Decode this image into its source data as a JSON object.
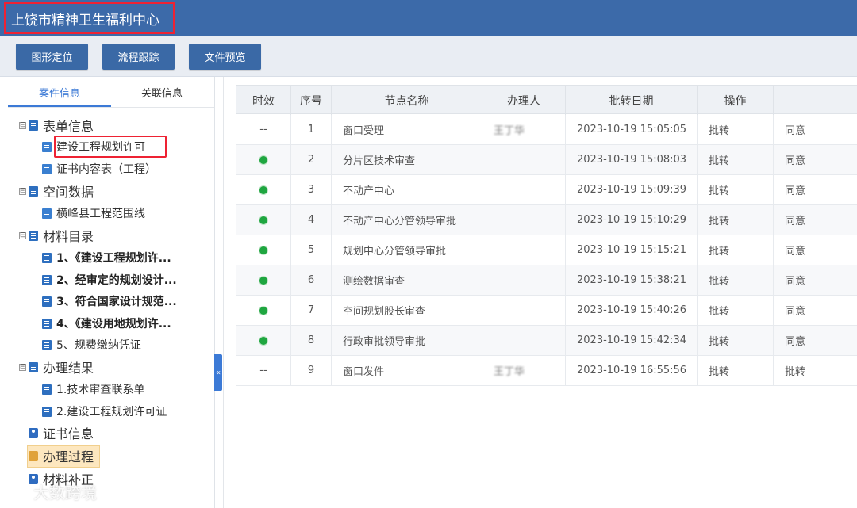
{
  "header": {
    "title": "上饶市精神卫生福利中心"
  },
  "toolbar": {
    "buttons": [
      "图形定位",
      "流程跟踪",
      "文件预览"
    ]
  },
  "sidebar": {
    "tabs": [
      "案件信息",
      "关联信息"
    ],
    "tree": [
      {
        "label": "表单信息",
        "toggle": "⊟"
      },
      {
        "label": "建设工程规划许可"
      },
      {
        "label": "证书内容表（工程）"
      },
      {
        "label": "空间数据",
        "toggle": "⊟"
      },
      {
        "label": "横峰县工程范围线"
      },
      {
        "label": "材料目录",
        "toggle": "⊟"
      },
      {
        "label": "1、《建设工程规划许..."
      },
      {
        "label": "2、经审定的规划设计..."
      },
      {
        "label": "3、符合国家设计规范..."
      },
      {
        "label": "4、《建设用地规划许..."
      },
      {
        "label": "5、规费缴纳凭证"
      },
      {
        "label": "办理结果",
        "toggle": "⊟"
      },
      {
        "label": "1.技术审查联系单"
      },
      {
        "label": "2.建设工程规划许可证"
      },
      {
        "label": "证书信息"
      },
      {
        "label": "办理过程"
      },
      {
        "label": "材料补正"
      }
    ],
    "collapse_glyph": "«"
  },
  "grid": {
    "headers": [
      "时效",
      "序号",
      "节点名称",
      "办理人",
      "批转日期",
      "操作",
      ""
    ],
    "rows": [
      {
        "status": "--",
        "seq": "1",
        "node": "窗口受理",
        "handler": "王丁华",
        "date": "2023-10-19 15:05:05",
        "op": "批转",
        "result": "同意"
      },
      {
        "status": "dot",
        "seq": "2",
        "node": "分片区技术审查",
        "handler": "",
        "date": "2023-10-19 15:08:03",
        "op": "批转",
        "result": "同意"
      },
      {
        "status": "dot",
        "seq": "3",
        "node": "不动产中心",
        "handler": "",
        "date": "2023-10-19 15:09:39",
        "op": "批转",
        "result": "同意"
      },
      {
        "status": "dot",
        "seq": "4",
        "node": "不动产中心分管领导审批",
        "handler": "",
        "date": "2023-10-19 15:10:29",
        "op": "批转",
        "result": "同意"
      },
      {
        "status": "dot",
        "seq": "5",
        "node": "规划中心分管领导审批",
        "handler": "",
        "date": "2023-10-19 15:15:21",
        "op": "批转",
        "result": "同意"
      },
      {
        "status": "dot",
        "seq": "6",
        "node": "测绘数据审查",
        "handler": "",
        "date": "2023-10-19 15:38:21",
        "op": "批转",
        "result": "同意"
      },
      {
        "status": "dot",
        "seq": "7",
        "node": "空间规划股长审查",
        "handler": "",
        "date": "2023-10-19 15:40:26",
        "op": "批转",
        "result": "同意"
      },
      {
        "status": "dot",
        "seq": "8",
        "node": "行政审批领导审批",
        "handler": "",
        "date": "2023-10-19 15:42:34",
        "op": "批转",
        "result": "同意"
      },
      {
        "status": "--",
        "seq": "9",
        "node": "窗口发件",
        "handler": "王丁华",
        "date": "2023-10-19 16:55:56",
        "op": "批转",
        "result": "批转"
      }
    ]
  },
  "watermark": {
    "text": "大数跨境"
  }
}
